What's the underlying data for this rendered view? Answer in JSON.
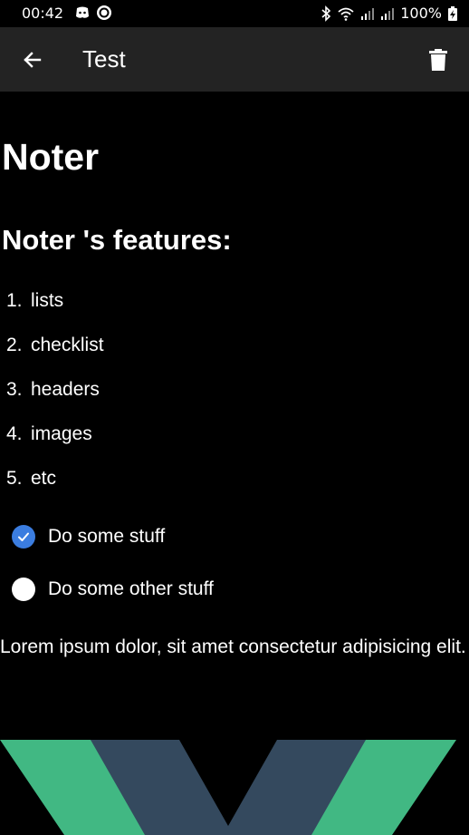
{
  "status_bar": {
    "time": "00:42",
    "battery": "100%",
    "icons": [
      "discord-icon",
      "app-icon",
      "bluetooth-icon",
      "wifi-icon",
      "signal-icon",
      "signal-icon",
      "battery-charging-icon"
    ]
  },
  "app_bar": {
    "title": "Test",
    "back_icon": "arrow-back-icon",
    "delete_icon": "trash-icon"
  },
  "note": {
    "h1": "Noter",
    "h2": "Noter 's features:",
    "list": [
      {
        "num": "1.",
        "text": "lists"
      },
      {
        "num": "2.",
        "text": "checklist"
      },
      {
        "num": "3.",
        "text": "headers"
      },
      {
        "num": "4.",
        "text": "images"
      },
      {
        "num": "5.",
        "text": "etc"
      }
    ],
    "checklist": [
      {
        "text": "Do some stuff",
        "checked": true
      },
      {
        "text": "Do some other stuff",
        "checked": false
      }
    ],
    "paragraph": "Lorem ipsum dolor, sit amet consectetur adipisicing elit.",
    "image": "vue-logo-image"
  },
  "colors": {
    "background": "#000000",
    "app_bar": "#232323",
    "checkbox_checked": "#3b7de0",
    "vue_green": "#41b883",
    "vue_dark": "#34495e"
  }
}
